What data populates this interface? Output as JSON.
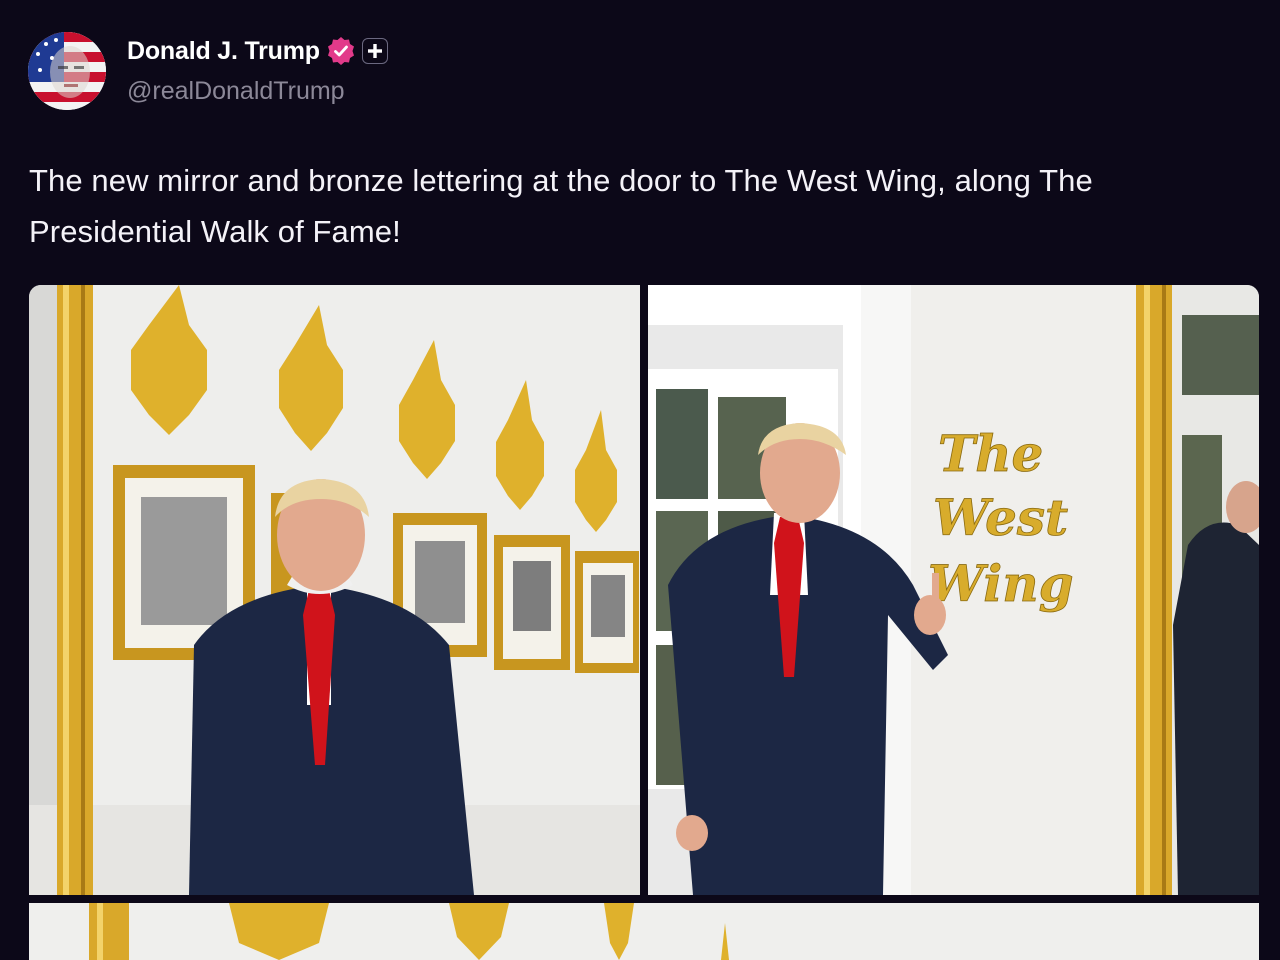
{
  "post": {
    "author": {
      "display_name": "Donald J. Trump",
      "handle": "@realDonaldTrump",
      "avatar_icon": "avatar-flag-portrait",
      "verified_icon": "verified-badge-icon",
      "plus_icon": "plus-badge-icon"
    },
    "text": "The new mirror and bronze lettering at the door to The West Wing, along The Presidential Walk of Fame!",
    "media": {
      "photo_1": {
        "sign_text": []
      },
      "photo_2": {
        "sign_text": [
          "The",
          "West",
          "Wing"
        ]
      }
    }
  },
  "colors": {
    "background": "#0c0818",
    "verified_badge": "#e23a8a",
    "handle_text": "#8c8898",
    "gold": "#d9a82a",
    "suit": "#1c2744",
    "tie": "#d0131b"
  }
}
